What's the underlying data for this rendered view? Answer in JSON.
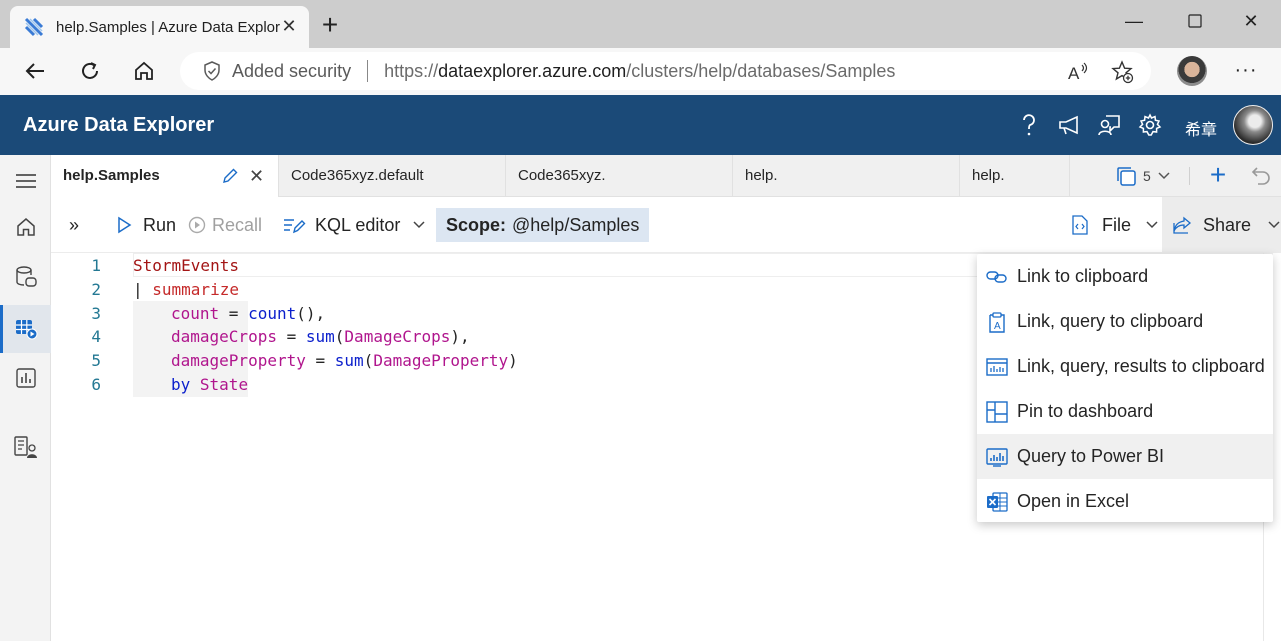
{
  "browser": {
    "tab_title": "help.Samples | Azure Data Explor",
    "security_label": "Added security",
    "url_prefix": "https://",
    "url_host": "dataexplorer.azure.com",
    "url_path": "/clusters/help/databases/Samples"
  },
  "app": {
    "title": "Azure Data Explorer",
    "user_name": "希章",
    "brand_color": "#1b4a78"
  },
  "tabs": {
    "items": [
      {
        "label": "help.Samples",
        "active": true
      },
      {
        "label": "Code365xyz.default"
      },
      {
        "label": "Code365xyz."
      },
      {
        "label": "help."
      },
      {
        "label": "help."
      }
    ],
    "count": "5"
  },
  "toolbar": {
    "run": "Run",
    "recall": "Recall",
    "editor_mode": "KQL editor",
    "scope_label": "Scope:",
    "scope_value": "@help/Samples",
    "file": "File",
    "share": "Share"
  },
  "editor": {
    "line_numbers": [
      "1",
      "2",
      "3",
      "4",
      "5",
      "6"
    ],
    "l1_table": "StormEvents",
    "l2_pipe": "| ",
    "l2_op": "summarize",
    "l3_col": "count",
    "l3_eq": " = ",
    "l3_fn": "count",
    "l3_tail": "(),",
    "l4_col": "damageCrops",
    "l4_eq": " = ",
    "l4_fn": "sum",
    "l4_open": "(",
    "l4_arg": "DamageCrops",
    "l4_tail": "),",
    "l5_col": "damageProperty",
    "l5_eq": " = ",
    "l5_fn": "sum",
    "l5_open": "(",
    "l5_arg": "DamageProperty",
    "l5_tail": ")",
    "l6_kw": "by",
    "l6_col": "State"
  },
  "share_menu": {
    "items": [
      {
        "label": "Link to clipboard",
        "icon": "link-icon"
      },
      {
        "label": "Link, query to clipboard",
        "icon": "link-query-icon"
      },
      {
        "label": "Link, query, results to clipboard",
        "icon": "link-query-results-icon"
      },
      {
        "label": "Pin to dashboard",
        "icon": "pin-dashboard-icon"
      },
      {
        "label": "Query to Power BI",
        "icon": "power-bi-icon",
        "hovered": true
      },
      {
        "label": "Open in Excel",
        "icon": "excel-icon"
      }
    ]
  }
}
